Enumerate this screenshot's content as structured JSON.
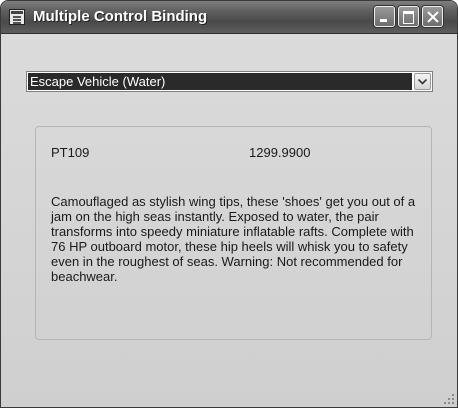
{
  "window": {
    "title": "Multiple Control Binding"
  },
  "combo": {
    "selected": "Escape Vehicle (Water)"
  },
  "product": {
    "name": "PT109",
    "price": "1299.9900",
    "description": "Camouflaged as stylish wing tips, these 'shoes' get you out of a jam on the high seas instantly. Exposed to water, the pair transforms into speedy miniature inflatable rafts. Complete with 76 HP outboard motor, these hip heels will whisk you to safety even in the roughest of seas. Warning: Not recommended for beachwear."
  },
  "icons": {
    "app": "form-icon",
    "minimize": "minimize-icon",
    "maximize": "maximize-icon",
    "close": "close-icon",
    "dropdown": "chevron-down-icon",
    "grip": "resize-grip-icon"
  }
}
